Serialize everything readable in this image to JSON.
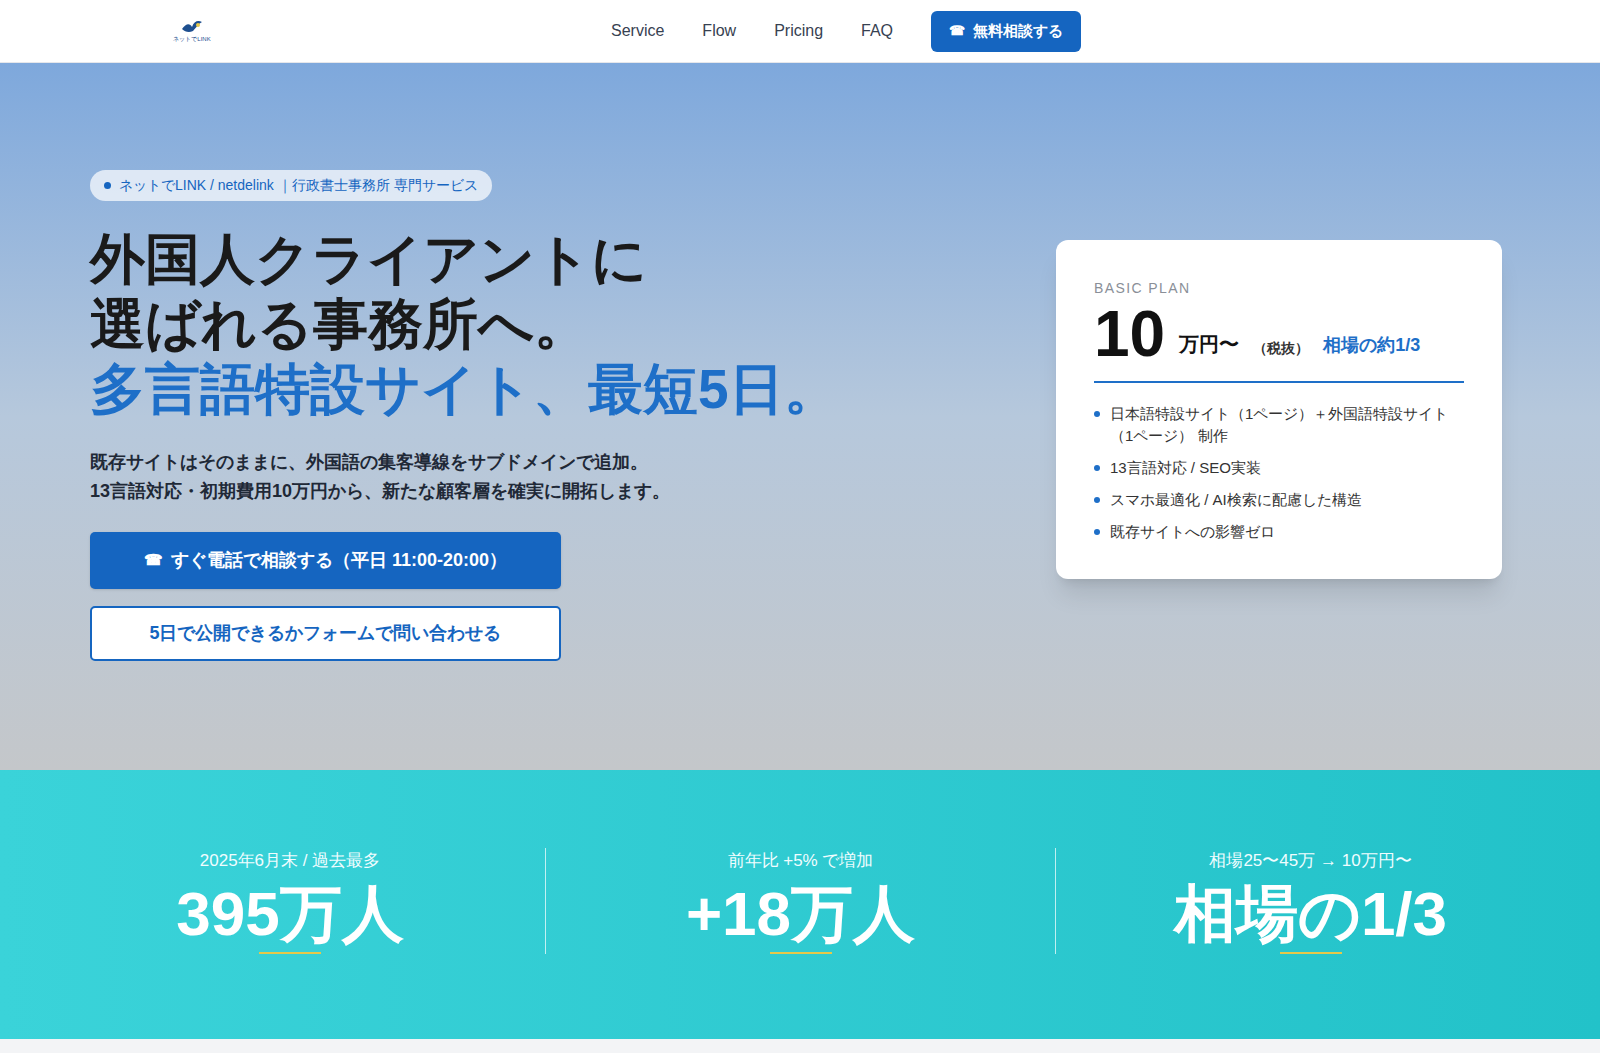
{
  "header": {
    "logo_text": "ネットでLINK",
    "nav": [
      {
        "label": "Service"
      },
      {
        "label": "Flow"
      },
      {
        "label": "Pricing"
      },
      {
        "label": "FAQ"
      }
    ],
    "cta": {
      "icon": "☎",
      "label": "無料相談する"
    }
  },
  "hero": {
    "badge": "ネットでLINK / netdelink ｜行政書士事務所 専門サービス",
    "title_lines": [
      "外国人クライアントに",
      "選ばれる事務所へ。"
    ],
    "title_highlight": "多言語特設サイト、最短5日。",
    "description": [
      "既存サイトはそのままに、外国語の集客導線をサブドメインで追加。",
      "13言語対応・初期費用10万円から、新たな顧客層を確実に開拓します。"
    ],
    "buttons": [
      {
        "icon": "☎",
        "label": "すぐ電話で相談する（平日 11:00-20:00）",
        "kind": "primary"
      },
      {
        "icon": "",
        "label": "5日で公開できるかフォームで問い合わせる",
        "kind": "outline"
      }
    ]
  },
  "plan": {
    "label": "BASIC PLAN",
    "price": "10",
    "unit": "万円〜",
    "tax": "（税抜）",
    "compare": "相場の約1/3",
    "features": [
      "日本語特設サイト（1ページ）＋外国語特設サイト（1ページ） 制作",
      "13言語対応 / SEO実装",
      "スマホ最適化 / AI検索に配慮した構造",
      "既存サイトへの影響ゼロ"
    ]
  },
  "stats": [
    {
      "caption": "2025年6月末 / 過去最多",
      "value": "395万人"
    },
    {
      "caption": "前年比 +5% で増加",
      "value": "+18万人"
    },
    {
      "caption": "相場25〜45万 → 10万円〜",
      "value": "相場の1/3"
    }
  ]
}
